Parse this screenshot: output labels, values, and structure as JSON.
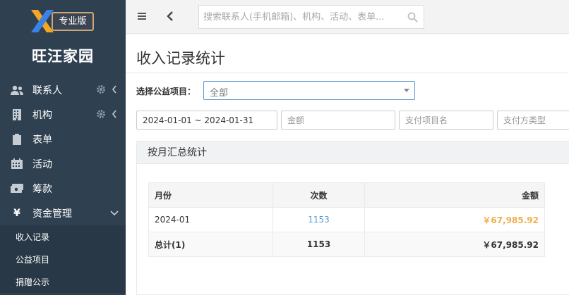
{
  "sidebar": {
    "edition_badge": "专业版",
    "brand": "旺汪家园",
    "items": [
      {
        "label": "联系人"
      },
      {
        "label": "机构"
      },
      {
        "label": "表单"
      },
      {
        "label": "活动"
      },
      {
        "label": "筹款"
      },
      {
        "label": "资金管理"
      }
    ],
    "sub_items": [
      {
        "label": "收入记录"
      },
      {
        "label": "公益项目"
      },
      {
        "label": "捐赠公示"
      }
    ],
    "currency_glyph": "¥"
  },
  "topbar": {
    "search_placeholder": "搜索联系人(手机邮箱)、机构、活动、表单..."
  },
  "main": {
    "title": "收入记录统计",
    "project_filter_label": "选择公益项目：",
    "project_selected": "全部",
    "date_range_value": "2024-01-01 ~ 2024-01-31",
    "amount_placeholder": "金额",
    "project_name_placeholder": "支付项目名",
    "pay_type_placeholder": "支付方类型"
  },
  "summary": {
    "panel_title": "按月汇总统计",
    "columns": {
      "month": "月份",
      "count": "次数",
      "amount": "金额"
    },
    "rows": [
      {
        "month": "2024-01",
        "count": "1153",
        "amount": "￥67,985.92"
      }
    ],
    "total": {
      "label": "总计(1)",
      "count": "1153",
      "amount": "￥67,985.92"
    }
  },
  "colors": {
    "sidebar_bg": "#2f4050",
    "accent_orange": "#f0ad4e",
    "link_blue": "#5b9bd5",
    "badge_border": "#c9a877"
  }
}
